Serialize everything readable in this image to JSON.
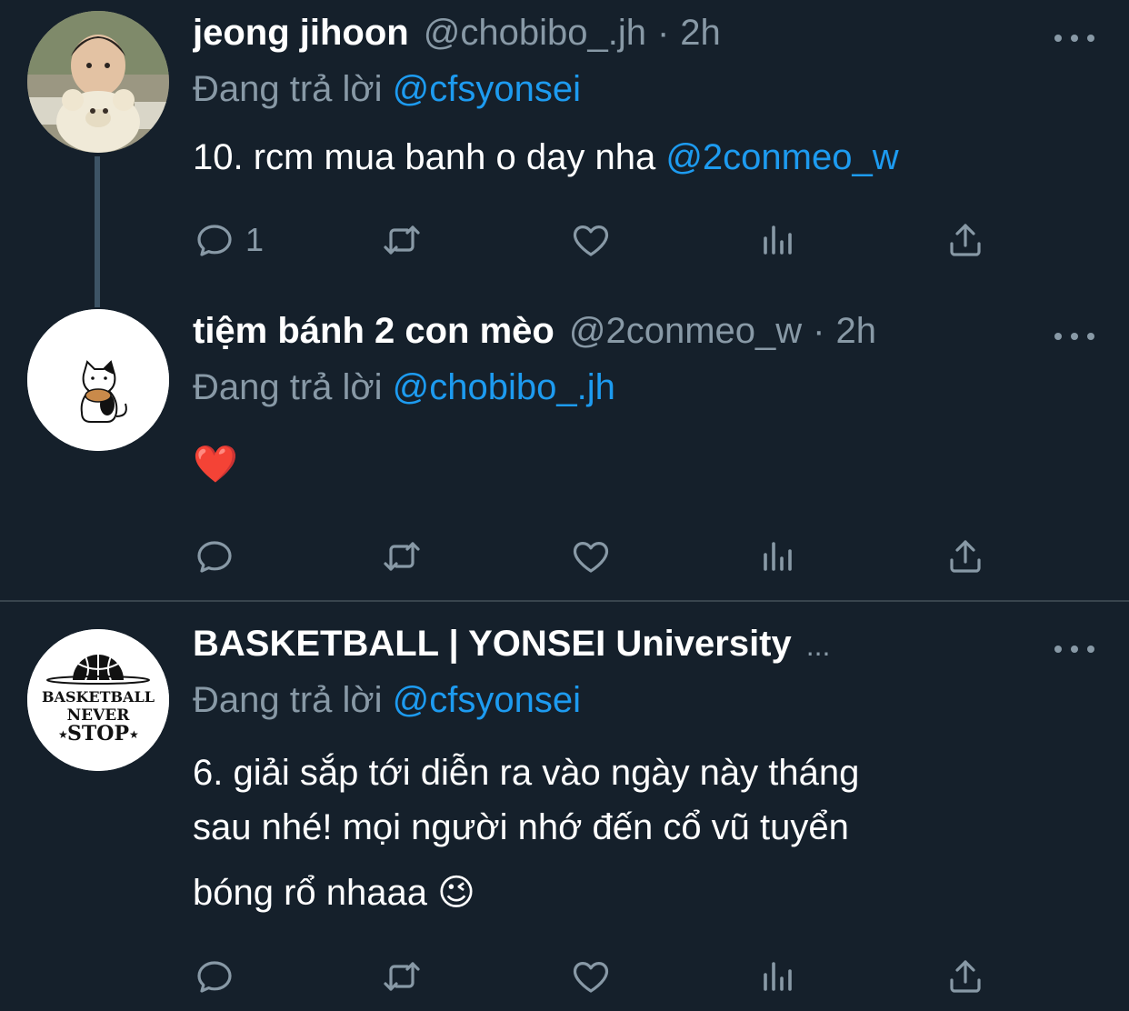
{
  "tweets": [
    {
      "name": "jeong jihoon",
      "handle": "@chobibo_.jh",
      "dot": "·",
      "time": "2h",
      "replying_prefix": "Đang trả lời",
      "replying_to": "@cfsyonsei",
      "text": "10. rcm mua banh o day nha",
      "mention": "@2conmeo_w",
      "reply_count": "1"
    },
    {
      "name": "tiệm bánh 2 con mèo",
      "handle": "@2conmeo_w",
      "dot": "·",
      "time": "2h",
      "replying_prefix": "Đang trả lời",
      "replying_to": "@chobibo_.jh",
      "text": "❤️"
    },
    {
      "name": "BASKETBALL | YONSEI University",
      "name_ellipsis": "...",
      "replying_prefix": "Đang trả lời",
      "replying_to": "@cfsyonsei",
      "text_line1": "6. giải sắp tới diễn ra vào ngày này tháng",
      "text_line2": "sau nhé! mọi người nhớ đến cổ vũ tuyển",
      "text_line3": "bóng rổ nhaaa 😉",
      "logo_text": [
        "BASKETBALL",
        "NEVER",
        "STOP"
      ]
    }
  ],
  "colors": {
    "background": "#15202b",
    "secondary_text": "#8899a6",
    "link": "#1d9bf0",
    "divider": "#38444d"
  },
  "icons": [
    "reply-icon",
    "retweet-icon",
    "like-icon",
    "analytics-icon",
    "share-icon",
    "more-icon"
  ]
}
